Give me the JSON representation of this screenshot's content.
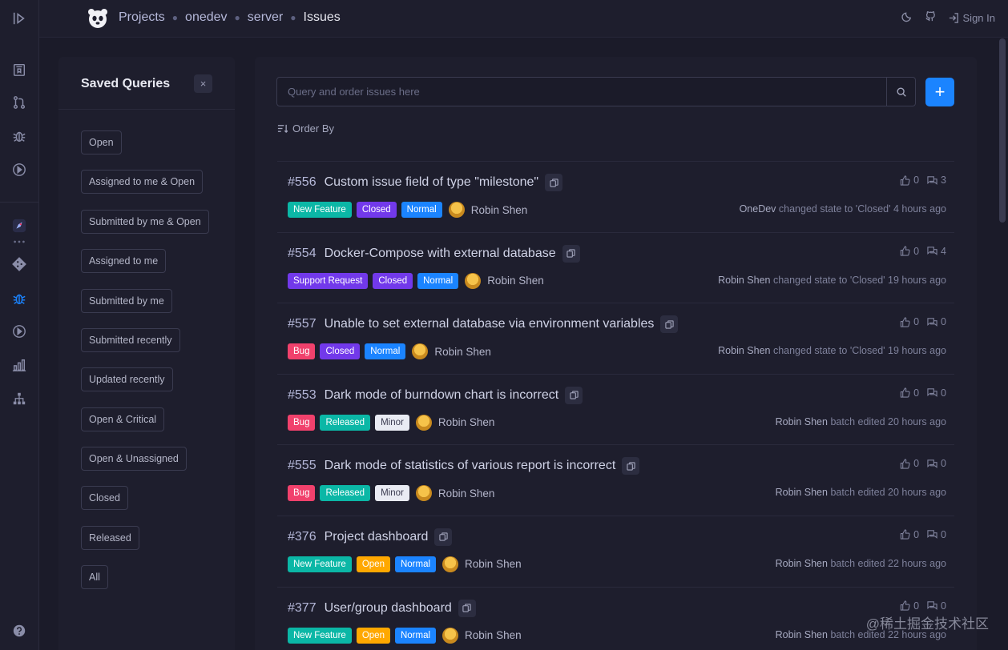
{
  "topbar": {
    "breadcrumbs": [
      "Projects",
      "onedev",
      "server",
      "Issues"
    ],
    "signin_label": "Sign In"
  },
  "saved_queries": {
    "title": "Saved Queries",
    "close_label": "×",
    "items": [
      "Open",
      "Assigned to me & Open",
      "Submitted by me & Open",
      "Assigned to me",
      "Submitted by me",
      "Submitted recently",
      "Updated recently",
      "Open & Critical",
      "Open & Unassigned",
      "Closed",
      "Released",
      "All"
    ]
  },
  "search": {
    "placeholder": "Query and order issues here",
    "add_label": "+"
  },
  "order_by_label": "Order By",
  "issues": [
    {
      "number": "#556",
      "title": "Custom issue field of type \"milestone\"",
      "labels": [
        {
          "text": "New Feature",
          "kind": "feature"
        },
        {
          "text": "Closed",
          "kind": "closed"
        },
        {
          "text": "Normal",
          "kind": "normal"
        }
      ],
      "user": "Robin Shen",
      "votes": "0",
      "comments": "3",
      "actor": "OneDev",
      "activity": "changed state to 'Closed' 4 hours ago"
    },
    {
      "number": "#554",
      "title": "Docker-Compose with external database",
      "labels": [
        {
          "text": "Support Request",
          "kind": "support"
        },
        {
          "text": "Closed",
          "kind": "closed"
        },
        {
          "text": "Normal",
          "kind": "normal"
        }
      ],
      "user": "Robin Shen",
      "votes": "0",
      "comments": "4",
      "actor": "Robin Shen",
      "activity": "changed state to 'Closed' 19 hours ago"
    },
    {
      "number": "#557",
      "title": "Unable to set external database via environment variables",
      "labels": [
        {
          "text": "Bug",
          "kind": "bug"
        },
        {
          "text": "Closed",
          "kind": "closed"
        },
        {
          "text": "Normal",
          "kind": "normal"
        }
      ],
      "user": "Robin Shen",
      "votes": "0",
      "comments": "0",
      "actor": "Robin Shen",
      "activity": "changed state to 'Closed' 19 hours ago"
    },
    {
      "number": "#553",
      "title": "Dark mode of burndown chart is incorrect",
      "labels": [
        {
          "text": "Bug",
          "kind": "bug"
        },
        {
          "text": "Released",
          "kind": "released"
        },
        {
          "text": "Minor",
          "kind": "minor"
        }
      ],
      "user": "Robin Shen",
      "votes": "0",
      "comments": "0",
      "actor": "Robin Shen",
      "activity": "batch edited 20 hours ago"
    },
    {
      "number": "#555",
      "title": "Dark mode of statistics of various report is incorrect",
      "labels": [
        {
          "text": "Bug",
          "kind": "bug"
        },
        {
          "text": "Released",
          "kind": "released"
        },
        {
          "text": "Minor",
          "kind": "minor"
        }
      ],
      "user": "Robin Shen",
      "votes": "0",
      "comments": "0",
      "actor": "Robin Shen",
      "activity": "batch edited 20 hours ago"
    },
    {
      "number": "#376",
      "title": "Project dashboard",
      "labels": [
        {
          "text": "New Feature",
          "kind": "feature"
        },
        {
          "text": "Open",
          "kind": "open"
        },
        {
          "text": "Normal",
          "kind": "normal"
        }
      ],
      "user": "Robin Shen",
      "votes": "0",
      "comments": "0",
      "actor": "Robin Shen",
      "activity": "batch edited 22 hours ago"
    },
    {
      "number": "#377",
      "title": "User/group dashboard",
      "labels": [
        {
          "text": "New Feature",
          "kind": "feature"
        },
        {
          "text": "Open",
          "kind": "open"
        },
        {
          "text": "Normal",
          "kind": "normal"
        }
      ],
      "user": "Robin Shen",
      "votes": "0",
      "comments": "0",
      "actor": "Robin Shen",
      "activity": "batch edited 22 hours ago"
    }
  ],
  "watermark": "@稀土掘金技术社区",
  "colors": {
    "accent": "#1b84ff",
    "bg": "#1b1b29",
    "panel": "#1e1e2d"
  }
}
